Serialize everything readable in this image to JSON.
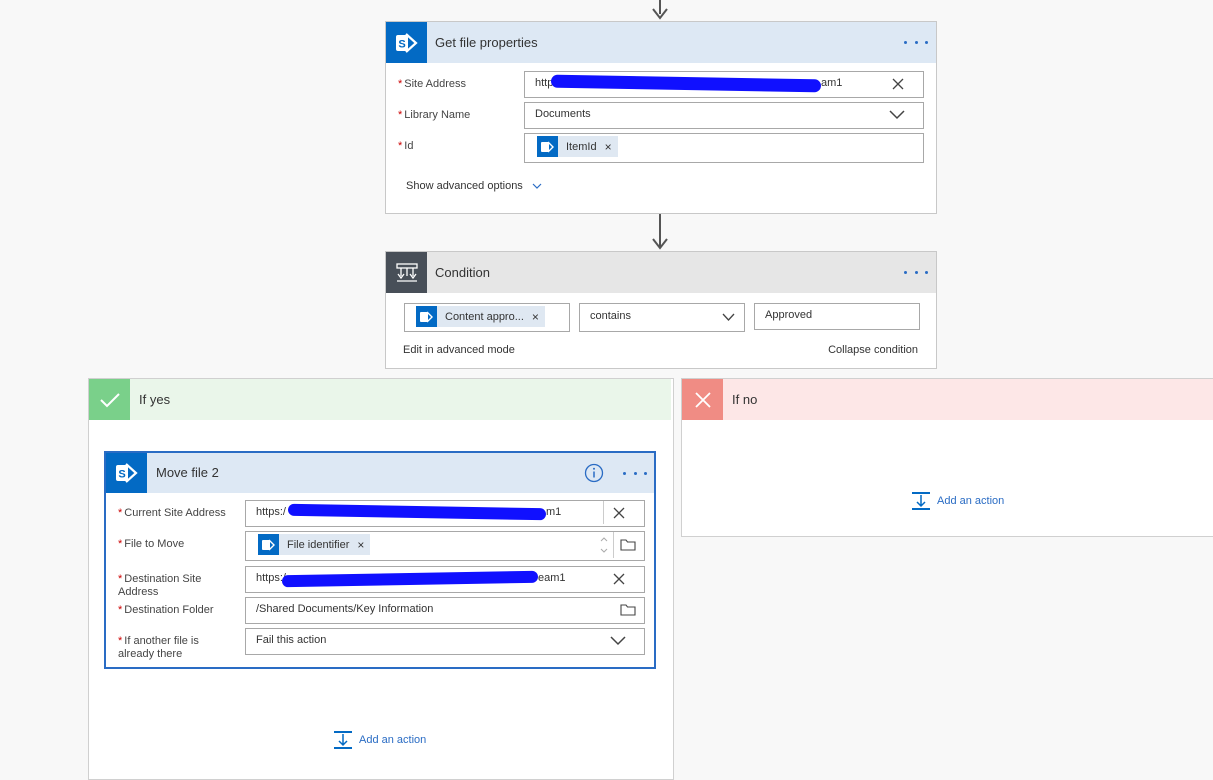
{
  "get_file": {
    "title": "Get file properties",
    "site_label": "Site Address",
    "site_value_start": "http",
    "site_value_end": "am1",
    "library_label": "Library Name",
    "library_value": "Documents",
    "id_label": "Id",
    "id_token": "ItemId",
    "show_advanced": "Show advanced options"
  },
  "condition": {
    "title": "Condition",
    "left_token": "Content appro...",
    "operator": "contains",
    "value": "Approved",
    "edit_advanced": "Edit in advanced mode",
    "collapse": "Collapse condition"
  },
  "if_yes": {
    "label": "If yes",
    "add_action": "Add an action"
  },
  "if_no": {
    "label": "If no",
    "add_action": "Add an action"
  },
  "move_file": {
    "title": "Move file 2",
    "current_site_label": "Current Site Address",
    "current_site_start": "https:/",
    "current_site_end": "m1",
    "file_to_move_label": "File to Move",
    "file_token": "File identifier",
    "dest_site_label": "Destination Site Address",
    "dest_site_start": "https:/",
    "dest_site_end": "eam1",
    "dest_folder_label": "Destination Folder",
    "dest_folder_value": "/Shared Documents/Key Information",
    "if_exists_label": "If another file is already there",
    "if_exists_value": "Fail this action"
  },
  "colors": {
    "sharepoint_blue": "#036ac4",
    "yes_green": "#7ad08a",
    "no_red": "#f08c84",
    "link_blue": "#2a6cc4"
  },
  "required_marker": "*",
  "token_remove": "×"
}
